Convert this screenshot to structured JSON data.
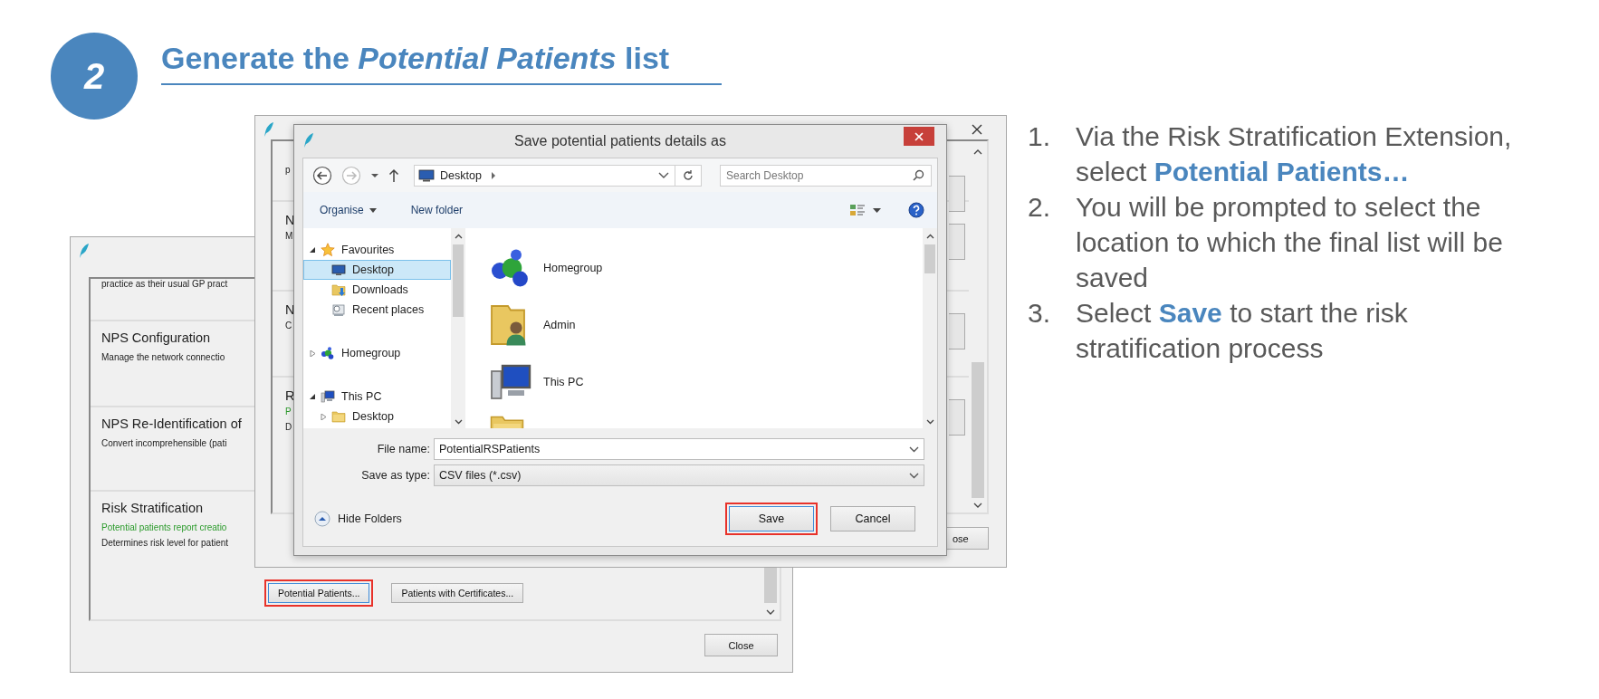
{
  "step": {
    "number": "2",
    "title": "Generate the *Potential Patients* list"
  },
  "back_window": {
    "rows": [
      {
        "lines": [
          {
            "text": "practice as their usual GP pract",
            "kind": "desc"
          }
        ]
      },
      {
        "title": "NPS Configuration",
        "lines": [
          {
            "text": "Manage the network connectio",
            "kind": "desc"
          }
        ]
      },
      {
        "title": "NPS Re-Identification of",
        "lines": [
          {
            "text": "Convert incomprehensible (pati",
            "kind": "desc"
          }
        ]
      },
      {
        "title": "Risk Stratification",
        "lines": [
          {
            "text": "Potential patients report creatio",
            "kind": "status"
          },
          {
            "text": "Determines risk level for patient",
            "kind": "desc"
          }
        ]
      }
    ],
    "buttons": [
      {
        "label": "Potential Patients...",
        "highlighted": true
      },
      {
        "label": "Patients with Certificates...",
        "highlighted": false
      }
    ],
    "close_button": "Close"
  },
  "middle_window": {
    "rows": [
      {
        "lines": [
          {
            "text": "p",
            "kind": "desc"
          }
        ]
      },
      {
        "title": "N",
        "lines": [
          {
            "text": "M",
            "kind": "desc"
          }
        ]
      },
      {
        "title": "N",
        "lines": [
          {
            "text": "C",
            "kind": "desc"
          }
        ]
      },
      {
        "title": "R",
        "lines": [
          {
            "text": "P",
            "kind": "status"
          },
          {
            "text": "D",
            "kind": "desc"
          }
        ]
      }
    ],
    "close_button": "ose"
  },
  "dialog": {
    "title": "Save potential patients details as",
    "address": "Desktop",
    "search_placeholder": "Search Desktop",
    "organise": "Organise",
    "new_folder": "New folder",
    "nav_tree": [
      {
        "label": "Favourites",
        "kind": "favourites",
        "expanded": true,
        "selected": false,
        "children": [
          {
            "label": "Desktop",
            "kind": "desktop",
            "selected": true
          },
          {
            "label": "Downloads",
            "kind": "downloads",
            "selected": false
          },
          {
            "label": "Recent places",
            "kind": "recent",
            "selected": false
          }
        ]
      },
      {
        "label": "Homegroup",
        "kind": "homegroup",
        "expanded": false,
        "selected": false
      },
      {
        "label": "This PC",
        "kind": "pc",
        "expanded": true,
        "selected": false,
        "children": [
          {
            "label": "Desktop",
            "kind": "folder",
            "expanded": false,
            "selected": false
          }
        ]
      }
    ],
    "files": [
      {
        "label": "Homegroup",
        "kind": "homegroup"
      },
      {
        "label": "Admin",
        "kind": "user"
      },
      {
        "label": "This PC",
        "kind": "pc"
      },
      {
        "kind": "folder"
      }
    ],
    "file_name_label": "File name:",
    "file_name": "PotentialRSPatients",
    "type_label": "Save as type:",
    "file_type": "CSV files (*.csv)",
    "hide_folders": "Hide Folders",
    "buttons": [
      {
        "label": "Save",
        "highlighted": true
      },
      {
        "label": "Cancel",
        "highlighted": false
      }
    ]
  },
  "instructions": [
    {
      "number": "1.",
      "text": "Via the Risk Stratification Extension, select **Potential Patients…**"
    },
    {
      "number": "2.",
      "text": "You will be prompted to select the location to which the final list will be saved"
    },
    {
      "number": "3.",
      "text": "Select **Save** to start the risk stratification process"
    }
  ]
}
